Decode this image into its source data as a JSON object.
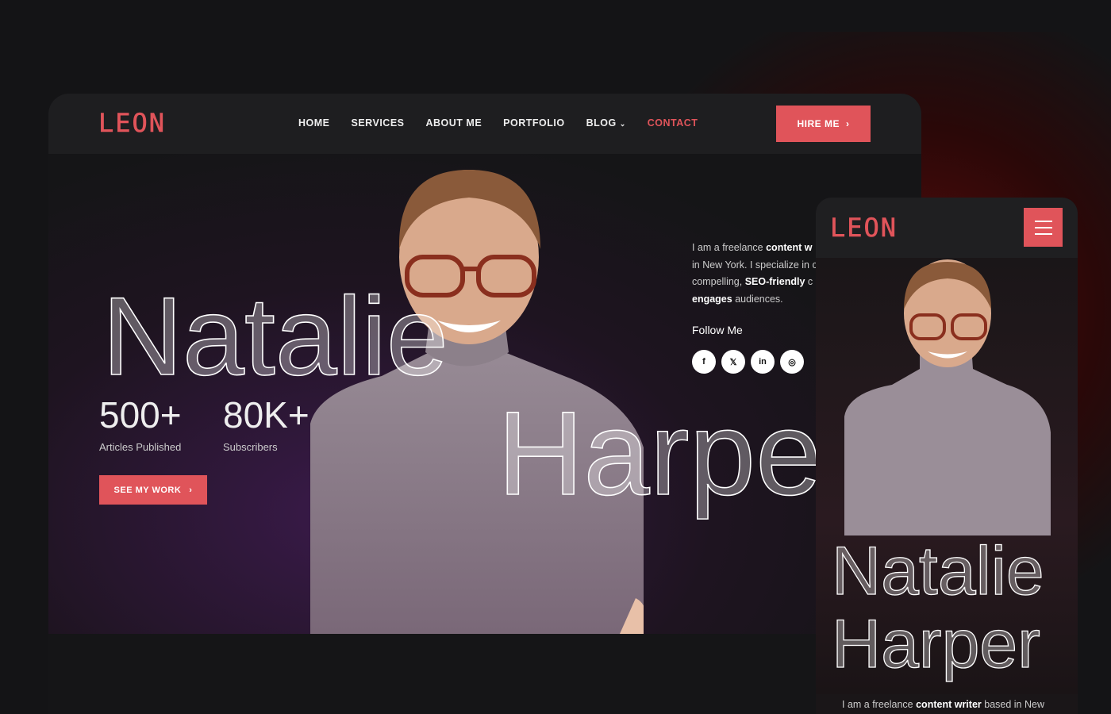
{
  "brand": "LEON",
  "nav": {
    "items": [
      "HOME",
      "SERVICES",
      "ABOUT ME",
      "PORTFOLIO",
      "BLOG",
      "CONTACT"
    ],
    "active": "CONTACT",
    "hire_label": "HIRE ME"
  },
  "hero": {
    "first_name": "Natalie",
    "last_name": "Harpe",
    "stats": [
      {
        "value": "500+",
        "label": "Articles Published"
      },
      {
        "value": "80K+",
        "label": "Subscribers"
      }
    ],
    "cta": "SEE MY WORK",
    "about": {
      "l1a": "I am a freelance ",
      "l1b": "content w",
      "l2": "in New York. I specialize in c",
      "l3a": "compelling, ",
      "l3b": "SEO-friendly",
      "l3c": " c",
      "l4a": "engages",
      "l4b": " audiences."
    },
    "follow": "Follow Me",
    "socials": [
      "facebook",
      "x",
      "linkedin",
      "instagram"
    ]
  },
  "mobile": {
    "first_name": "Natalie",
    "last_name": "Harper",
    "intro_a": "I am a freelance ",
    "intro_b": "content writer",
    "intro_c": " based in New"
  },
  "colors": {
    "accent": "#e0545a",
    "bg": "#151517"
  }
}
